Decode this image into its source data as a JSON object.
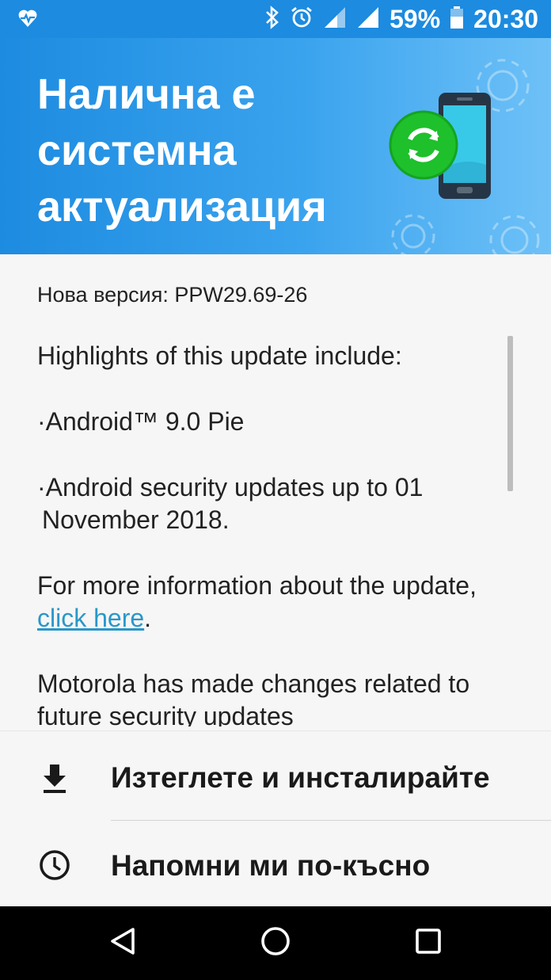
{
  "status_bar": {
    "battery_percent": "59%",
    "time": "20:30",
    "icons": [
      "heart-monitor-icon",
      "bluetooth-icon",
      "alarm-icon",
      "signal-icon",
      "signal-icon",
      "battery-icon"
    ]
  },
  "header": {
    "title": "Налична е системна актуализация",
    "illustration": [
      "phone-icon",
      "sync-icon",
      "gear-icon"
    ],
    "colors": {
      "banner_start": "#1d8be0",
      "banner_end": "#6ec1f7",
      "sync_badge": "#1ec02b"
    }
  },
  "content": {
    "version": "Нова версия: PPW29.69-26",
    "highlights_heading": "Highlights of this update include:",
    "bullets": [
      "·Android™ 9.0 Pie",
      "·Android security updates up to 01 November 2018."
    ],
    "more_info_prefix": "For more information about the update, ",
    "more_info_link": "click here",
    "more_info_suffix": ".",
    "motorola_note": "Motorola has made changes related to future security updates",
    "link_color": "#2a97c9"
  },
  "actions": {
    "download_install": {
      "label": "Изтеглете и инсталирайте",
      "icon": "download-icon"
    },
    "remind_later": {
      "label": "Напомни ми по-късно",
      "icon": "clock-icon"
    }
  },
  "nav_bar": {
    "icons": [
      "back-icon",
      "home-icon",
      "recents-icon"
    ]
  }
}
